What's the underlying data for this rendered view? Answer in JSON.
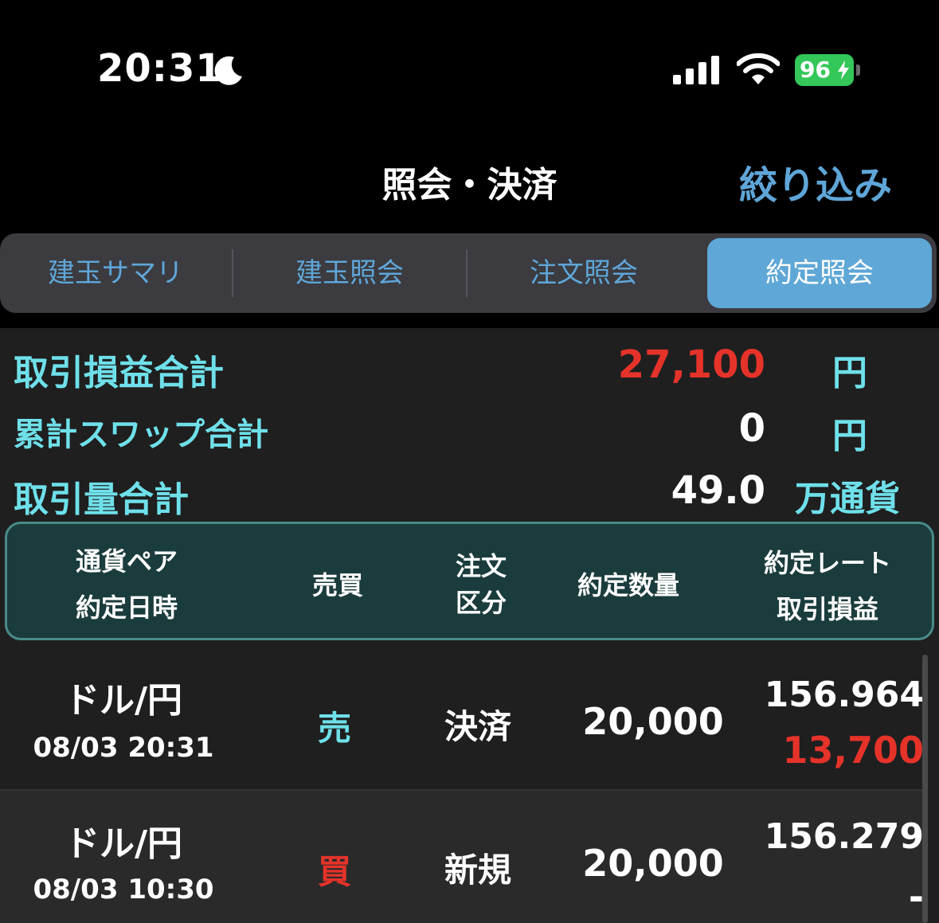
{
  "status_bar": {
    "time": "20:31",
    "battery": "96"
  },
  "header": {
    "title": "照会・決済",
    "filter_label": "絞り込み"
  },
  "tabs": [
    {
      "label": "建玉サマリ",
      "active": false
    },
    {
      "label": "建玉照会",
      "active": false
    },
    {
      "label": "注文照会",
      "active": false
    },
    {
      "label": "約定照会",
      "active": true
    }
  ],
  "summary": {
    "pnl": {
      "label": "取引損益合計",
      "value": "27,100",
      "unit": "円"
    },
    "swap": {
      "label": "累計スワップ合計",
      "value": "0",
      "unit": "円"
    },
    "volume": {
      "label": "取引量合計",
      "value": "49.0",
      "unit": "万通貨"
    }
  },
  "table_header": {
    "pair": "通貨ペア",
    "datetime": "約定日時",
    "side": "売買",
    "order_type_line1": "注文",
    "order_type_line2": "区分",
    "quantity": "約定数量",
    "rate": "約定レート",
    "pnl": "取引損益"
  },
  "rows": [
    {
      "pair": "ドル/円",
      "datetime": "08/03 20:31",
      "side": "売",
      "side_color": "#6fe0ea",
      "order_type": "決済",
      "quantity": "20,000",
      "rate": "156.964",
      "pnl": "13,700",
      "pnl_color": "#e5332a"
    },
    {
      "pair": "ドル/円",
      "datetime": "08/03 10:30",
      "side": "買",
      "side_color": "#e5332a",
      "order_type": "新規",
      "quantity": "20,000",
      "rate": "156.279",
      "pnl": "-",
      "pnl_color": "#ffffff"
    }
  ],
  "colors": {
    "accent": "#5fa6d8",
    "label_teal": "#6fe0ea",
    "positive_red": "#e5332a",
    "header_bg": "#1b3c3c"
  }
}
